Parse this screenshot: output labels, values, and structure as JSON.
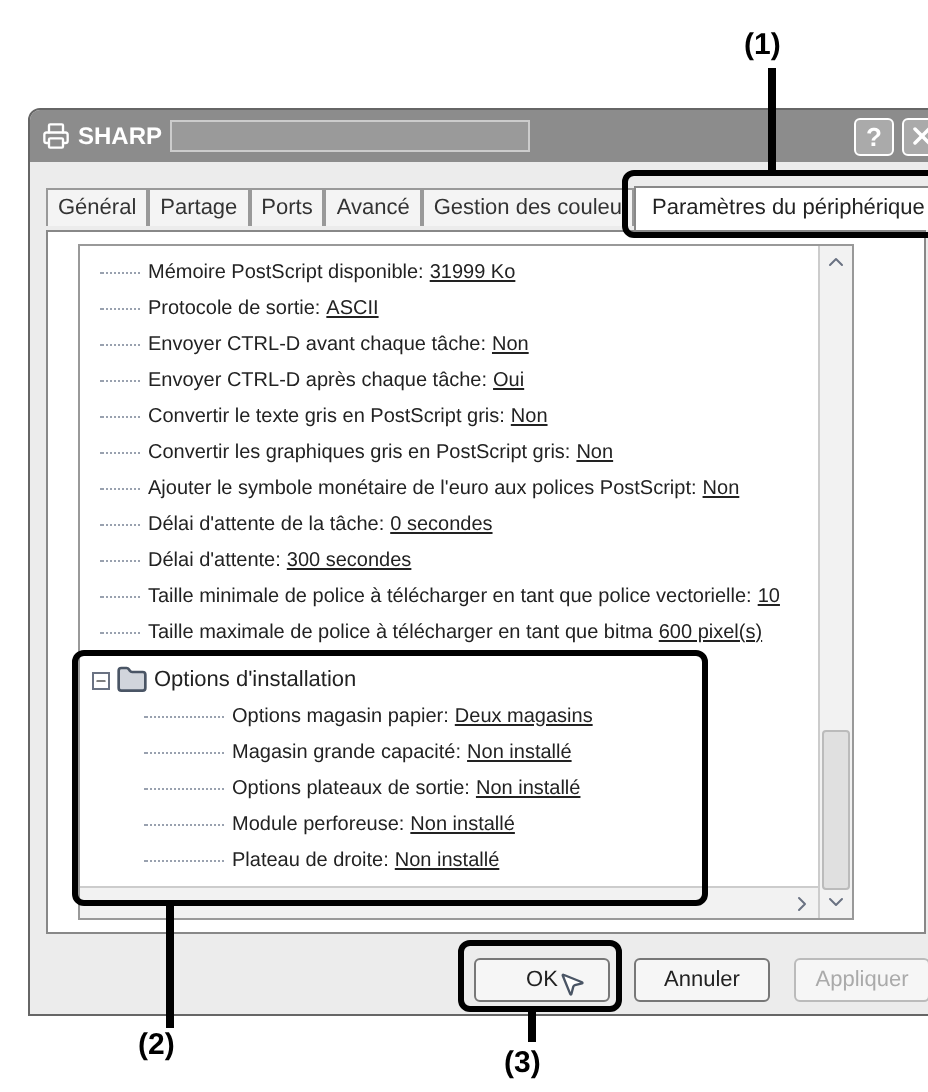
{
  "window": {
    "title": "SHARP",
    "help_button": "?"
  },
  "tabs": [
    {
      "label": "Général",
      "selected": false
    },
    {
      "label": "Partage",
      "selected": false
    },
    {
      "label": "Ports",
      "selected": false
    },
    {
      "label": "Avancé",
      "selected": false
    },
    {
      "label": "Gestion des couleu",
      "selected": false
    },
    {
      "label": "Paramètres du périphérique",
      "selected": true
    }
  ],
  "tree": {
    "items": [
      {
        "label": "Mémoire PostScript disponible:",
        "value": "31999 Ko"
      },
      {
        "label": "Protocole de sortie:",
        "value": "ASCII"
      },
      {
        "label": "Envoyer CTRL-D avant chaque tâche:",
        "value": "Non"
      },
      {
        "label": "Envoyer CTRL-D après chaque tâche:",
        "value": "Oui"
      },
      {
        "label": "Convertir le texte gris en PostScript gris:",
        "value": "Non"
      },
      {
        "label": "Convertir les graphiques gris en PostScript gris:",
        "value": "Non"
      },
      {
        "label": "Ajouter le symbole monétaire de l'euro aux polices PostScript:",
        "value": "Non"
      },
      {
        "label": "Délai d'attente de la tâche:",
        "value": "0 secondes"
      },
      {
        "label": "Délai d'attente:",
        "value": "300 secondes"
      },
      {
        "label": "Taille minimale de police à télécharger en tant que police vectorielle:",
        "value": "10"
      },
      {
        "label": "Taille maximale de police à télécharger en tant que bitma",
        "value": "600 pixel(s)"
      }
    ],
    "group": {
      "label": "Options d'installation",
      "expanded": true,
      "children": [
        {
          "label": "Options magasin papier:",
          "value": "Deux magasins"
        },
        {
          "label": "Magasin grande capacité:",
          "value": "Non installé"
        },
        {
          "label": "Options plateaux de sortie:",
          "value": "Non installé"
        },
        {
          "label": "Module perforeuse:",
          "value": "Non installé"
        },
        {
          "label": "Plateau de droite:",
          "value": "Non installé"
        }
      ]
    }
  },
  "buttons": [
    {
      "label": "OK",
      "disabled": false
    },
    {
      "label": "Annuler",
      "disabled": false
    },
    {
      "label": "Appliquer",
      "disabled": true
    }
  ],
  "callouts": [
    "(1)",
    "(2)",
    "(3)"
  ]
}
